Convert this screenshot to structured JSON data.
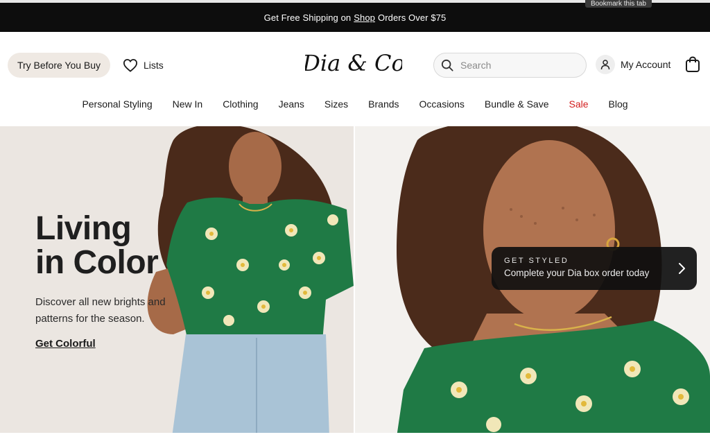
{
  "browser": {
    "tooltip": "Bookmark this tab"
  },
  "promo": {
    "before": "Get Free Shipping on",
    "link": "Shop",
    "after": "Orders Over $75"
  },
  "header": {
    "try_button": "Try Before You Buy",
    "lists_label": "Lists",
    "logo_text": "Dia & Co",
    "search_placeholder": "Search",
    "account_label": "My Account"
  },
  "nav": {
    "items": [
      {
        "label": "Personal Styling"
      },
      {
        "label": "New In"
      },
      {
        "label": "Clothing"
      },
      {
        "label": "Jeans"
      },
      {
        "label": "Sizes"
      },
      {
        "label": "Brands"
      },
      {
        "label": "Occasions"
      },
      {
        "label": "Bundle & Save"
      },
      {
        "label": "Sale"
      },
      {
        "label": "Blog"
      }
    ]
  },
  "hero": {
    "title_line1": "Living",
    "title_line2": "in Color",
    "subtitle": "Discover all new brights and patterns for the season.",
    "cta": "Get Colorful"
  },
  "styled_card": {
    "kicker": "GET STYLED",
    "message": "Complete your Dia box order today"
  },
  "colors": {
    "promo_bg": "#0d0d0d",
    "sale": "#d21d1d",
    "blouse_green": "#1f7a45",
    "hero_bg_left": "#ebe6e1"
  }
}
